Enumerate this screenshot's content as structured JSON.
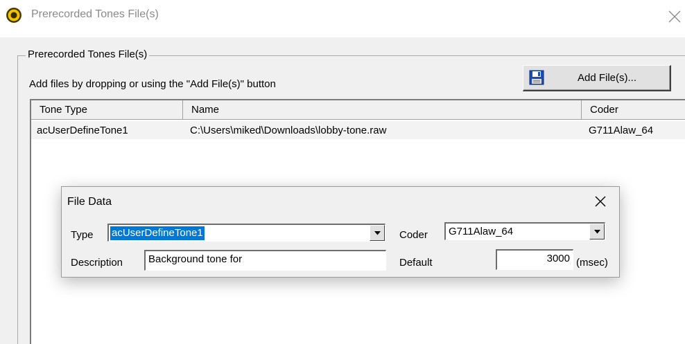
{
  "window": {
    "title": "Prerecorded Tones File(s)"
  },
  "group": {
    "legend": "Prerecorded Tones File(s)",
    "hint": "Add files by dropping or using the \"Add File(s)\" button",
    "add_button_label": "Add File(s)..."
  },
  "table": {
    "columns": [
      "Tone Type",
      "Name",
      "Coder"
    ],
    "rows": [
      {
        "tone_type": "acUserDefineTone1",
        "name": "C:\\Users\\miked\\Downloads\\lobby-tone.raw",
        "coder": "G711Alaw_64"
      }
    ]
  },
  "file_data": {
    "title": "File Data",
    "type_label": "Type",
    "type_value": "acUserDefineTone1",
    "coder_label": "Coder",
    "coder_value": "G711Alaw_64",
    "description_label": "Description",
    "description_value": "Background tone for",
    "default_label": "Default",
    "default_value": "3000",
    "default_unit": "(msec)"
  },
  "colors": {
    "selection": "#0078d7",
    "dialog_bg": "#f0f0f0"
  },
  "icons": [
    "app-icon",
    "close-icon",
    "floppy-disk-icon",
    "dropdown-arrow-icon"
  ]
}
